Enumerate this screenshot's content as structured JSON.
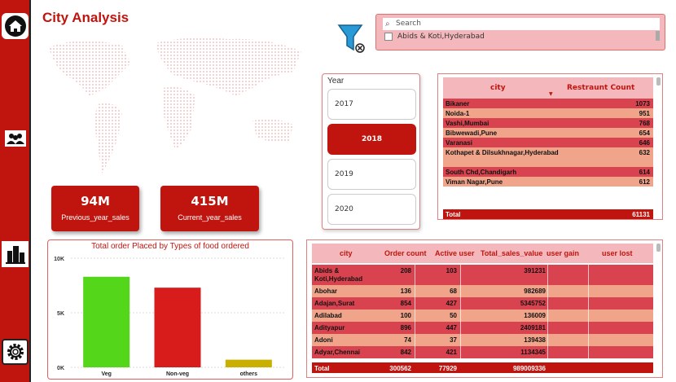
{
  "page": {
    "title": "City Analysis"
  },
  "nav": [
    {
      "icon": "home-icon"
    },
    {
      "icon": "people-icon"
    },
    {
      "icon": "city-icon"
    },
    {
      "icon": "gear-icon"
    }
  ],
  "kpis": [
    {
      "value": "94M",
      "label": "Previous_year_sales"
    },
    {
      "value": "415M",
      "label": "Current_year_sales"
    }
  ],
  "search_slicer": {
    "placeholder": "Search",
    "item": "Abids & Koti,Hyderabad"
  },
  "year_slicer": {
    "label": "Year",
    "options": [
      "2017",
      "2018",
      "2019",
      "2020"
    ],
    "selected": "2018"
  },
  "city_table": {
    "columns": [
      "city",
      "Restraunt Count"
    ],
    "rows": [
      [
        "Bikaner",
        "1073"
      ],
      [
        "Noida-1",
        "951"
      ],
      [
        "Vashi,Mumbai",
        "768"
      ],
      [
        "Bibwewadi,Pune",
        "654"
      ],
      [
        "Varanasi",
        "646"
      ],
      [
        "Kothapet & Dilsukhnagar,Hyderabad",
        "632"
      ],
      [
        "South Chd,Chandigarh",
        "614"
      ],
      [
        "Viman Nagar,Pune",
        "612"
      ]
    ],
    "total_label": "Total",
    "total_value": "61131"
  },
  "sales_table": {
    "columns": [
      "city",
      "Order count",
      "Active user",
      "Total_sales_value",
      "user gain",
      "user lost"
    ],
    "rows": [
      [
        "Abids & Koti,Hyderabad",
        "208",
        "103",
        "391231"
      ],
      [
        "Abohar",
        "136",
        "68",
        "982689"
      ],
      [
        "Adajan,Surat",
        "854",
        "427",
        "5345752"
      ],
      [
        "Adilabad",
        "100",
        "50",
        "136009"
      ],
      [
        "Adityapur",
        "896",
        "447",
        "2409181"
      ],
      [
        "Adoni",
        "74",
        "37",
        "139438"
      ],
      [
        "Adyar,Chennai",
        "842",
        "421",
        "1134345"
      ]
    ],
    "total": [
      "Total",
      "300562",
      "77929",
      "989009336"
    ]
  },
  "chart_data": {
    "type": "bar",
    "title": "Total order Placed by Types of food ordered",
    "categories": [
      "Veg",
      "Non-veg",
      "others"
    ],
    "values": [
      8300,
      7300,
      700
    ],
    "colors": [
      "#54d61a",
      "#d81b1b",
      "#c9b000"
    ],
    "yticks": [
      "0K",
      "5K",
      "10K"
    ],
    "ylim": [
      0,
      10000
    ],
    "grid": true
  },
  "colors": {
    "accent": "#c0150f",
    "row_dark": "#d9434f",
    "row_light": "#f0a48a",
    "header": "#f4b8bc"
  }
}
